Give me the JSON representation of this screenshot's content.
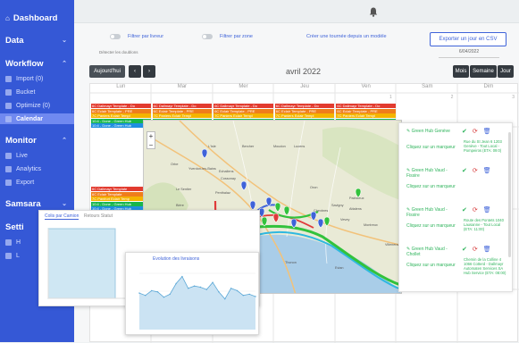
{
  "sidebar": {
    "dashboard": "Dashboard",
    "sections": [
      {
        "label": "Data",
        "items": []
      },
      {
        "label": "Workflow",
        "items": [
          {
            "label": "Import (0)"
          },
          {
            "label": "Bucket"
          },
          {
            "label": "Optimize (0)"
          },
          {
            "label": "Calendar",
            "active": true
          }
        ]
      },
      {
        "label": "Monitor",
        "items": [
          {
            "label": "Live"
          },
          {
            "label": "Analytics"
          },
          {
            "label": "Export"
          }
        ]
      },
      {
        "label": "Samsara",
        "items": []
      },
      {
        "label": "Setti",
        "items": [
          {
            "label": "H"
          },
          {
            "label": "L"
          }
        ]
      }
    ]
  },
  "filters": {
    "filter_driver": "Filtrer par livreur",
    "filter_zone": "Filtrer par zone",
    "create_tour": "Créer une tournée depuis un modèle",
    "export_label": "Exporter un jour en CSV",
    "export_date": "6/04/2022",
    "note": "Détecter les doublons"
  },
  "calendar": {
    "today": "Aujourd'hui",
    "prev": "‹",
    "next": "›",
    "title": "avril 2022",
    "views": [
      "Mois",
      "Semaine",
      "Jour"
    ],
    "days": [
      "Lun",
      "Mar",
      "Mer",
      "Jeu",
      "Ven",
      "Sam",
      "Dim"
    ],
    "day_numbers": [
      "",
      "",
      "",
      "",
      "1",
      "2",
      "3"
    ]
  },
  "events_row1": [
    {
      "text": "6C Dallmayr Template - Do",
      "color": "#e23b2f"
    },
    {
      "text": "6C Eclair Template - PRE",
      "color": "#ef7d1b"
    },
    {
      "text": "7C Paniers Eclair Templ",
      "color": "#f4b400"
    },
    {
      "text": "10:4 - Done - Green Hub",
      "color": "#18b64b"
    },
    {
      "text": "10:4 - Done - Green Hub",
      "color": "#1f8fe0"
    }
  ],
  "events_row2": [
    {
      "text": "6C Dallmayr Template",
      "color": "#e23b2f"
    },
    {
      "text": "6C Eclair Template",
      "color": "#ef7d1b"
    },
    {
      "text": "7C Panifort Eclair Temp",
      "color": "#f4b400"
    },
    {
      "text": "10:4 - Done - Green Hub",
      "color": "#18b64b"
    },
    {
      "text": "10:4 - Done - Green Hub",
      "color": "#1f8fe0"
    }
  ],
  "map_labels": {
    "zoom_in": "+",
    "zoom_out": "−",
    "places": [
      "Yverdon-les-Bains",
      "Orbe",
      "L'Isle",
      "Echallens",
      "Moudon",
      "Bercher",
      "Cossonay",
      "Penthalaz",
      "Oron",
      "Le Sentier",
      "Lausanne",
      "Vevey",
      "Montreux",
      "Morges",
      "Rolle",
      "Nyon",
      "Genève",
      "Thonon",
      "Evian",
      "Savigny",
      "Chexbres",
      "Prilly",
      "Bière",
      "Aubonne",
      "Lucens",
      "Palézieux",
      "Attalens",
      "Villeneuve"
    ]
  },
  "panel": {
    "entries": [
      {
        "hub": "Green Hub Genève",
        "click": "Cliquez sur un marqueur",
        "address": "Rue du St Jean 6 1203 Genève - Tout Local - Pompeiros (ETA: 09:0)"
      },
      {
        "hub": "Green Hub Vaud - Fissire",
        "click": "Cliquez sur un marqueur",
        "address": ""
      },
      {
        "hub": "Green Hub Vaud - Fissire",
        "click": "Cliquez sur un marqueur",
        "address": "Route des Pontets 1040 Lausanne - Tout Local (ETA: 11:00)"
      },
      {
        "hub": "Green Hub Vaud - Chollet",
        "click": "Cliquez sur un marqueur",
        "address": "Chemin de la Colline 4 1066 Cotterd - Dallmayr Automaten Services SA Hub Service (ETA: 08:00)"
      }
    ]
  },
  "charts": {
    "tabs": [
      "Colis par Camion",
      "Retours Statut"
    ],
    "chart_small_title": "Evolution des livraisons"
  },
  "chart_data": {
    "type": "area",
    "x": [
      0,
      1,
      2,
      3,
      4,
      5,
      6,
      7,
      8,
      9,
      10,
      11,
      12,
      13,
      14,
      15,
      16,
      17,
      18,
      19
    ],
    "series": [
      {
        "values": [
          62,
          58,
          66,
          64,
          55,
          60,
          78,
          90,
          70,
          74,
          72,
          68,
          80,
          64,
          52,
          70,
          66,
          58,
          60,
          56
        ]
      }
    ],
    "ylim": [
      0,
      100
    ]
  },
  "colors": {
    "sidebar": "#3558d6",
    "accent": "#3f63d9",
    "hub_green": "#2fb45c",
    "route_green": "#32c23c",
    "route_red": "#e03a3a"
  }
}
